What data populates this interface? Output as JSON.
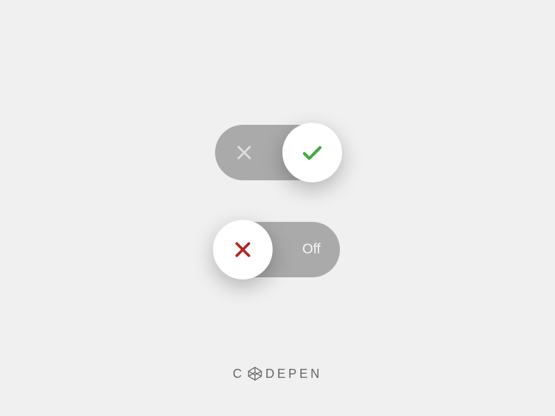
{
  "toggles": {
    "on": {
      "state": "on",
      "off_icon_name": "x",
      "on_icon_name": "check"
    },
    "off": {
      "state": "off",
      "label_right": "Off",
      "off_icon_name": "x"
    }
  },
  "footer": {
    "brand_prefix": "C",
    "brand_suffix": "DEPEN",
    "logo_icon_name": "cube"
  },
  "colors": {
    "background": "#f0f0f0",
    "track": "#aaaaaa",
    "knob": "#ffffff",
    "check_green": "#3fa843",
    "x_red": "#b42222",
    "x_light": "#dddddd",
    "footer_text": "#666666"
  }
}
